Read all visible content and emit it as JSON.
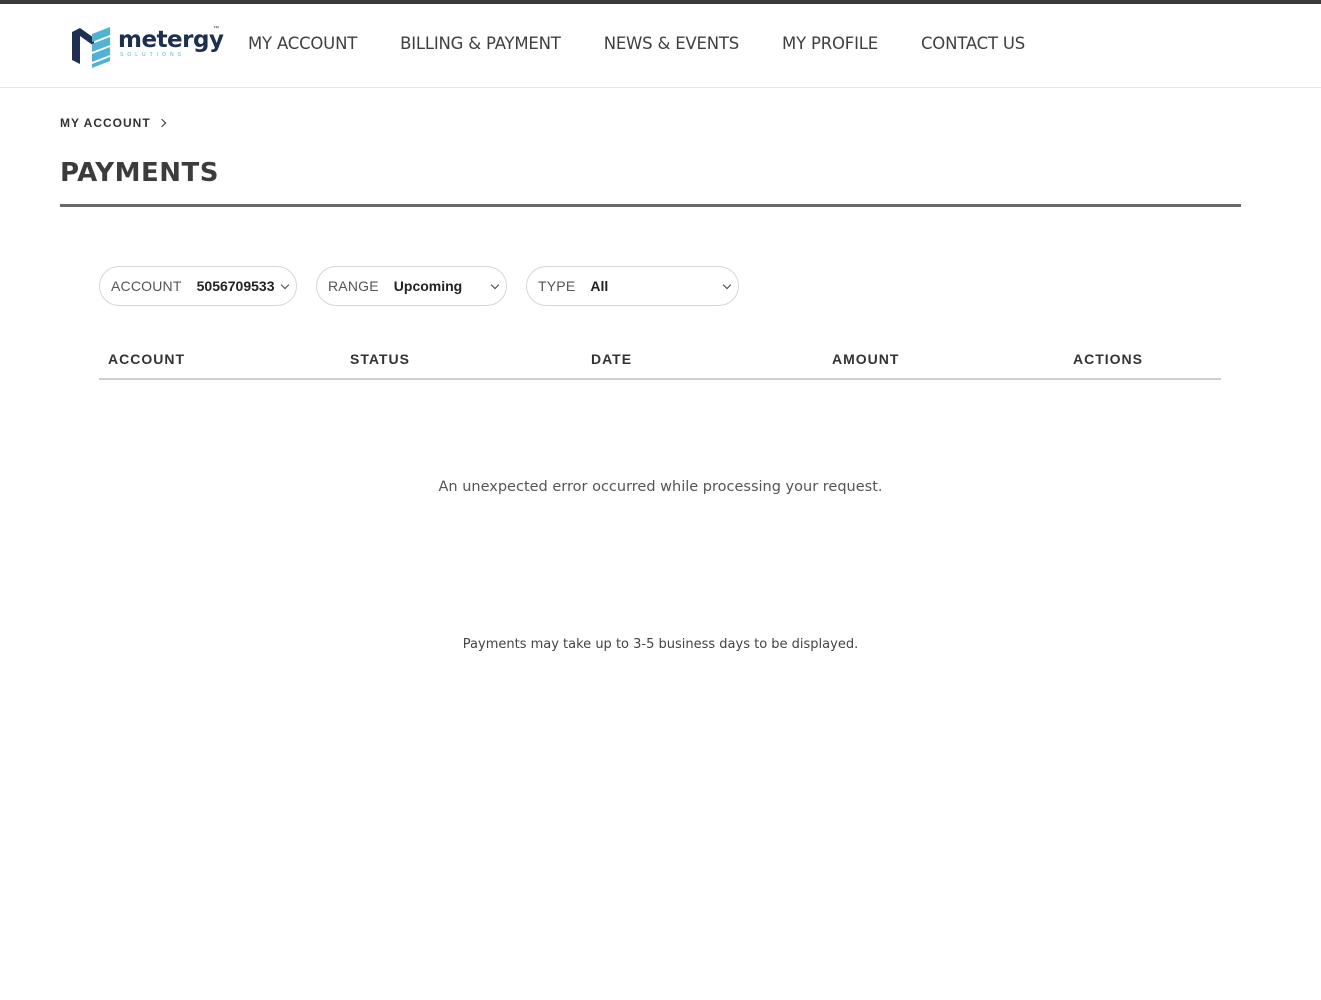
{
  "brand": {
    "name": "metergy",
    "tagline": "SOLUTIONS",
    "colors": {
      "navy": "#1d2f52",
      "teal": "#4fb3d6"
    }
  },
  "nav": {
    "items": [
      {
        "label": "MY ACCOUNT"
      },
      {
        "label": "BILLING & PAYMENT"
      },
      {
        "label": "NEWS & EVENTS"
      },
      {
        "label": "MY PROFILE"
      },
      {
        "label": "CONTACT US"
      }
    ]
  },
  "breadcrumb": {
    "label": "MY ACCOUNT",
    "icon": "chevron-right-icon"
  },
  "page": {
    "title": "PAYMENTS"
  },
  "filters": {
    "account": {
      "label": "ACCOUNT",
      "value": "5056709533"
    },
    "range": {
      "label": "RANGE",
      "value": "Upcoming"
    },
    "type": {
      "label": "TYPE",
      "value": "All"
    }
  },
  "table": {
    "columns": [
      "ACCOUNT",
      "STATUS",
      "DATE",
      "AMOUNT",
      "ACTIONS"
    ]
  },
  "messages": {
    "error": "An unexpected error occurred while processing your request.",
    "note": "Payments may take up to 3-5 business days to be displayed."
  }
}
